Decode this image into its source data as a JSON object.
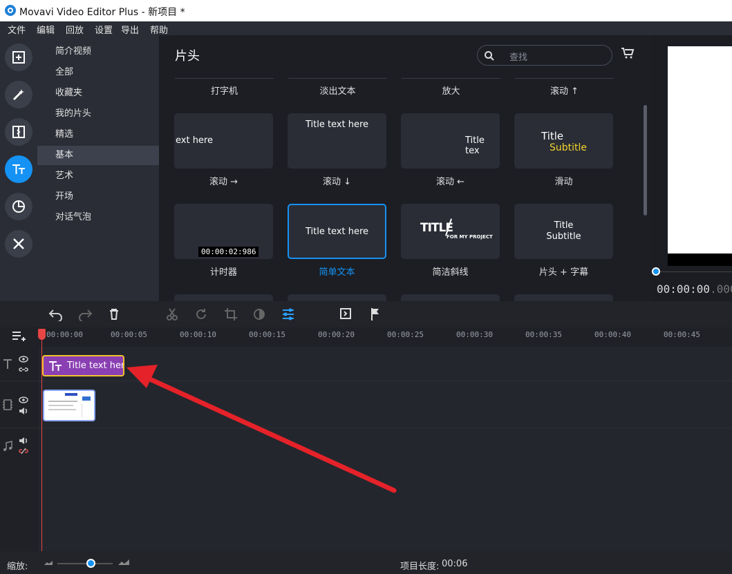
{
  "window": {
    "title": "Movavi Video Editor Plus - 新项目 *"
  },
  "menu": [
    "文件",
    "编辑",
    "回放",
    "设置",
    "导出",
    "帮助"
  ],
  "categories": [
    "简介视频",
    "全部",
    "收藏夹",
    "我的片头",
    "精选",
    "基本",
    "艺术",
    "开场",
    "对话气泡"
  ],
  "active_category": "基本",
  "gallery": {
    "heading": "片头",
    "search_placeholder": "查找",
    "top_labels": [
      "打字机",
      "淡出文本",
      "放大",
      "滚动 ↑"
    ],
    "row1": [
      {
        "text": "ext here",
        "label": "滚动 →"
      },
      {
        "text": "Title text here",
        "label": "滚动 ↓"
      },
      {
        "text": "Title tex",
        "label": "滚动 ←"
      },
      {
        "text": "Title",
        "sub": "Subtitle",
        "label": "滑动"
      }
    ],
    "row2": [
      {
        "text": "00:00:02:986",
        "label": "计时器"
      },
      {
        "text": "Title text here",
        "label": "简单文本"
      },
      {
        "text": "TITLE",
        "sub": "FOR MY PROJECT",
        "label": "简洁斜线"
      },
      {
        "text": "Title",
        "sub": "Subtitle",
        "label": "片头 + 字幕"
      }
    ]
  },
  "preview": {
    "timecode": "00:00:00",
    "timecode_frac": ".000"
  },
  "ruler_labels": [
    "00:00:00",
    "00:00:05",
    "00:00:10",
    "00:00:15",
    "00:00:20",
    "00:00:25",
    "00:00:30",
    "00:00:35",
    "00:00:40",
    "00:00:45"
  ],
  "title_clip_text": "Title text here",
  "status": {
    "zoom_label": "缩放:",
    "project_length_label": "项目长度:",
    "project_length": "00:06"
  },
  "colors": {
    "accent": "#1592f4",
    "clip_purple": "#8a3fb3",
    "clip_border": "#f2c230",
    "arrow": "#e52229"
  }
}
